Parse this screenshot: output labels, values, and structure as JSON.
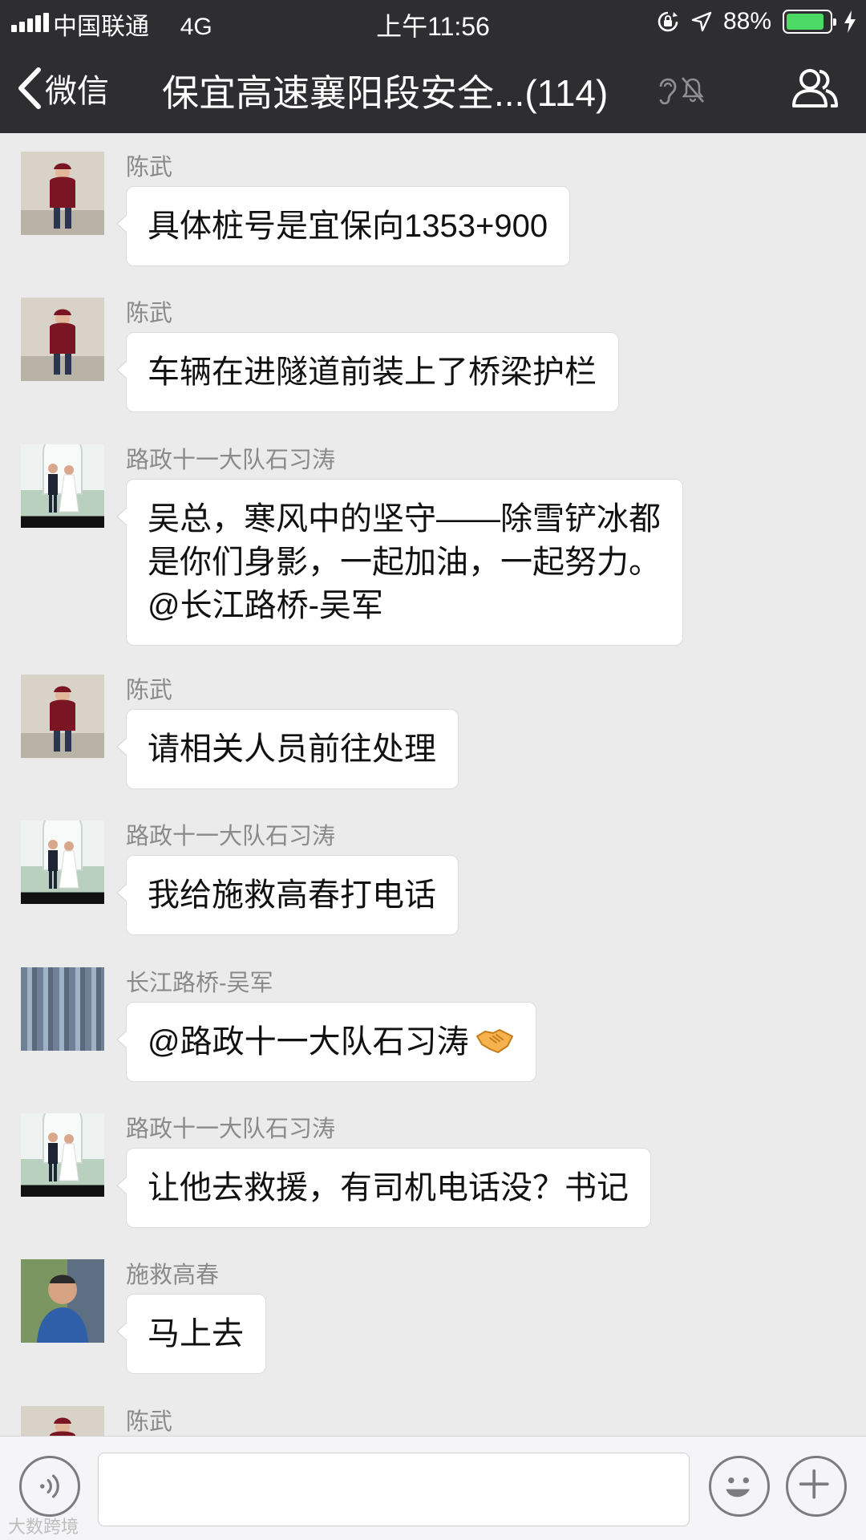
{
  "status_bar": {
    "carrier": "中国联通",
    "network": "4G",
    "time": "上午11:56",
    "battery_percent": "88%",
    "battery_level": 0.88,
    "icons": [
      "signal-icon",
      "orientation-lock-icon",
      "location-arrow-icon",
      "battery-icon",
      "charging-bolt-icon"
    ]
  },
  "nav": {
    "back_label": "微信",
    "title": "保宜高速襄阳段安全...(114)",
    "icons": [
      "back-chevron-icon",
      "earpiece-icon",
      "mute-bell-icon",
      "group-members-icon"
    ]
  },
  "messages": [
    {
      "sender": "陈武",
      "avatar": "boy-in-red-jacket",
      "lines": [
        "具体桩号是宜保向1353+900"
      ]
    },
    {
      "sender": "陈武",
      "avatar": "boy-in-red-jacket",
      "lines": [
        "车辆在进隧道前装上了桥梁护栏"
      ]
    },
    {
      "sender": "路政十一大队石习涛",
      "avatar": "wedding-couple",
      "lines": [
        "吴总，寒风中的坚守——除雪铲冰都",
        "是你们身影，一起加油，一起努力。",
        "@长江路桥-吴军"
      ]
    },
    {
      "sender": "陈武",
      "avatar": "boy-in-red-jacket",
      "lines": [
        "请相关人员前往处理"
      ]
    },
    {
      "sender": "路政十一大队石习涛",
      "avatar": "wedding-couple",
      "lines": [
        "我给施救高春打电话"
      ]
    },
    {
      "sender": "长江路桥-吴军",
      "avatar": "inscribed-wall",
      "lines": [
        "@路政十一大队石习涛"
      ],
      "emoji": "handshake-emoji"
    },
    {
      "sender": "路政十一大队石习涛",
      "avatar": "wedding-couple",
      "lines": [
        "让他去救援，有司机电话没？书记"
      ]
    },
    {
      "sender": "施救高春",
      "avatar": "man-portrait",
      "lines": [
        "马上去"
      ]
    },
    {
      "sender": "陈武",
      "avatar": "boy-in-red-jacket",
      "lines": []
    }
  ],
  "input_bar": {
    "text_value": "",
    "icons": [
      "voice-icon",
      "emoji-icon",
      "plus-icon"
    ]
  },
  "watermark": "大数跨境",
  "colors": {
    "nav_background": "#2e2e31",
    "chat_background": "#ebebeb",
    "bubble_background": "#ffffff",
    "battery_green": "#4cd964",
    "sender_gray": "#8a8a8a"
  }
}
